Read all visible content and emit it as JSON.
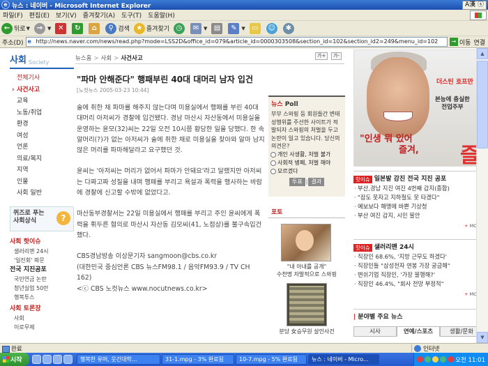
{
  "window": {
    "title": "뉴스 : 네이버 - Microsoft Internet Explorer",
    "ime": "A漢 ⓢ"
  },
  "menu": [
    "파일(F)",
    "편집(E)",
    "보기(V)",
    "즐겨찾기(A)",
    "도구(T)",
    "도움말(H)"
  ],
  "toolbar": {
    "back": "뒤로",
    "search": "검색",
    "favorites": "즐겨찾기"
  },
  "address": {
    "label": "주소(D)",
    "url": "http://news.naver.com/news/read.php?mode=LSS2D&office_id=079&article_id=0000303508&section_id=102&section_id2=249&menu_id=102",
    "go": "이동",
    "links": "연결"
  },
  "nav": {
    "section": "사회",
    "section_en": "Society",
    "items": [
      "전체기사",
      "사건사고",
      "교육",
      "노동/취업",
      "환경",
      "여성",
      "언론",
      "의료/복지",
      "지역",
      "인물",
      "사회 일반"
    ],
    "quiz": "퀴즈로 푸는\n사회상식",
    "hot_title": "사회 핫이슈",
    "hot_items": [
      "샐러리맨 24시",
      "'일진회' 파문"
    ],
    "accident_title": "전국 지진공포",
    "accident_items": [
      "국민연금 논란",
      "청년실업 50만",
      "행복투스"
    ],
    "debate_title": "사회 토론장",
    "debate_items": [
      "사회",
      "이로무제"
    ]
  },
  "breadcrumb": {
    "home": "뉴스홈",
    "section": "사회",
    "current": "사건사고",
    "font_up": "가+",
    "font_down": "가-"
  },
  "article": {
    "headline": "\"파마 안해준다\" 행패부린 40대 대머리 남자 입건",
    "meta": "[노컷뉴스 2005-03-23 10:44]",
    "p1": "술에 취한 채 파마를 해주지 않는다며 미용실에서 행패를 부린 40대 대머리 아저씨가 경찰에 입건됐다. 경남 마산시 자산동에서 미용실을 운영하는 윤모(32)씨는 22일 오전 10시쯤 황당한 일을 당했다. 한 속알머리(?)가 없는 아저씨가 술에 취한 채로 미용실을 찾아와 알마 남지 않은 머리를 파마해달라고 요구했던 것.",
    "p2": "윤씨는 '아저씨는 머리가 없어서 파마가 안돼요'라고 달랬지만 아저씨는 다짜고짜 성질을 내며 행패를 부리고 욕설과 폭력을 행사하는 바람에 경찰에 신고할 수밖에 없었다고.",
    "p3": "마산동부경찰서는 22일 미용실에서 행패를 부리고 주인 윤씨에게 폭력을 휘두른 혐의로 마산시 자산동 김모씨(41, 노점상)를 불구속입건했다.",
    "p4a": "CBS경남방송 이상문기자 sangmoon@cbs.co.kr",
    "p4b": "(대한민국 중심언론 CBS 뉴스FM98.1 / 음악FM93.9 / TV CH 162)",
    "p4c": "<ⓒ CBS 노컷뉴스 www.nocutnews.co.kr>"
  },
  "poll": {
    "title_a": "뉴스",
    "title_b": "Poll",
    "question": "부부 스와핑 등 회원들간 변태 성행위를 주선한 사이트가 적발되자 스와핑의 처벌을 두고 논란이 일고 있습니다. 당신의 의견은?",
    "options": [
      "개인 사생활, 처벌 불가",
      "사회적 병폐, 처벌 해야",
      "모르겠다"
    ],
    "vote": "투표",
    "result": "결과"
  },
  "photo": {
    "title_a": "포토",
    "title_b": "",
    "cap1": "\"내 아내를 공개\"\n수천명 자발적으로 스와핑",
    "cap2": "분당 女승무원 살인사건"
  },
  "ad": {
    "name": "더스틴 호프만",
    "sub": "본능에 충실한\n전업주부",
    "slogan1": "\"인생 뭐 있어",
    "slogan2": "즐겨,",
    "big": "즐"
  },
  "right": {
    "box1_badge": "핫이슈",
    "box1_title": "일본발 강진 전국 지진 공포",
    "box1_items": [
      "부산,경남 지진 여진 4번째 감지(종합)",
      "\"잠도 못자고 지하철도 못 타겠다\"",
      "예보보다 해맹에 바쁜 기상청",
      "부산 여진 감지, 시민 불안"
    ],
    "box2_badge": "핫이슈",
    "box2_title": "샐러리맨 24시",
    "box2_items": [
      "직장인 68.6%, '지방 근무도 하겠다'",
      "직장인들 \"삼성전자 연봉 가장 궁금해\"",
      "변쉬기업 직장인, '가장 불행해?'",
      "직장인 46.4%, \"회사 전망 부정적\""
    ],
    "more": "MORE",
    "box3_title": "분야별 주요 뉴스",
    "tabs": [
      "시사",
      "연예/스포츠",
      "생활/문화"
    ]
  },
  "status": {
    "text": "완료",
    "zone": "인터넷"
  },
  "taskbar": {
    "start": "시작",
    "tasks": [
      "행복한 유머, 웃긴대학...",
      "31-1.mpg - 3% 완료됨",
      "10-7.mpg - 5% 완료됨",
      "뉴스 : 네이버 - Micro..."
    ],
    "clock": "오전 11:01"
  }
}
